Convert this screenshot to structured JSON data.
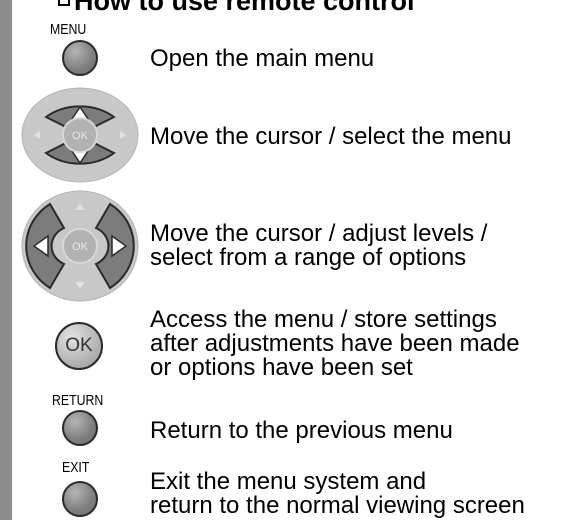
{
  "header": {
    "title": "How to use remote control"
  },
  "rows": [
    {
      "button_label": "MENU",
      "description": [
        "Open the main menu"
      ]
    },
    {
      "button_label": "",
      "description": [
        "Move the cursor / select the menu"
      ],
      "ok_label": "OK",
      "highlight": "up-down"
    },
    {
      "button_label": "",
      "description": [
        "Move the cursor / adjust levels /",
        "select from a range of options"
      ],
      "ok_label": "OK",
      "highlight": "left-right"
    },
    {
      "button_label": "",
      "description": [
        "Access the menu / store settings",
        "after adjustments have been made",
        "or options have been set"
      ],
      "ok_label": "OK"
    },
    {
      "button_label": "RETURN",
      "description": [
        "Return to the previous menu"
      ]
    },
    {
      "button_label": "EXIT",
      "description": [
        "Exit the menu system and",
        "return to the normal viewing screen"
      ]
    }
  ]
}
